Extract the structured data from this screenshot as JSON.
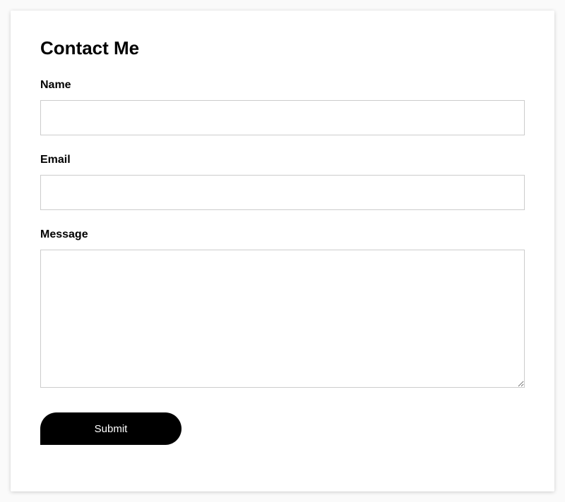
{
  "form": {
    "title": "Contact Me",
    "fields": {
      "name": {
        "label": "Name",
        "value": ""
      },
      "email": {
        "label": "Email",
        "value": ""
      },
      "message": {
        "label": "Message",
        "value": ""
      }
    },
    "submit_label": "Submit"
  }
}
